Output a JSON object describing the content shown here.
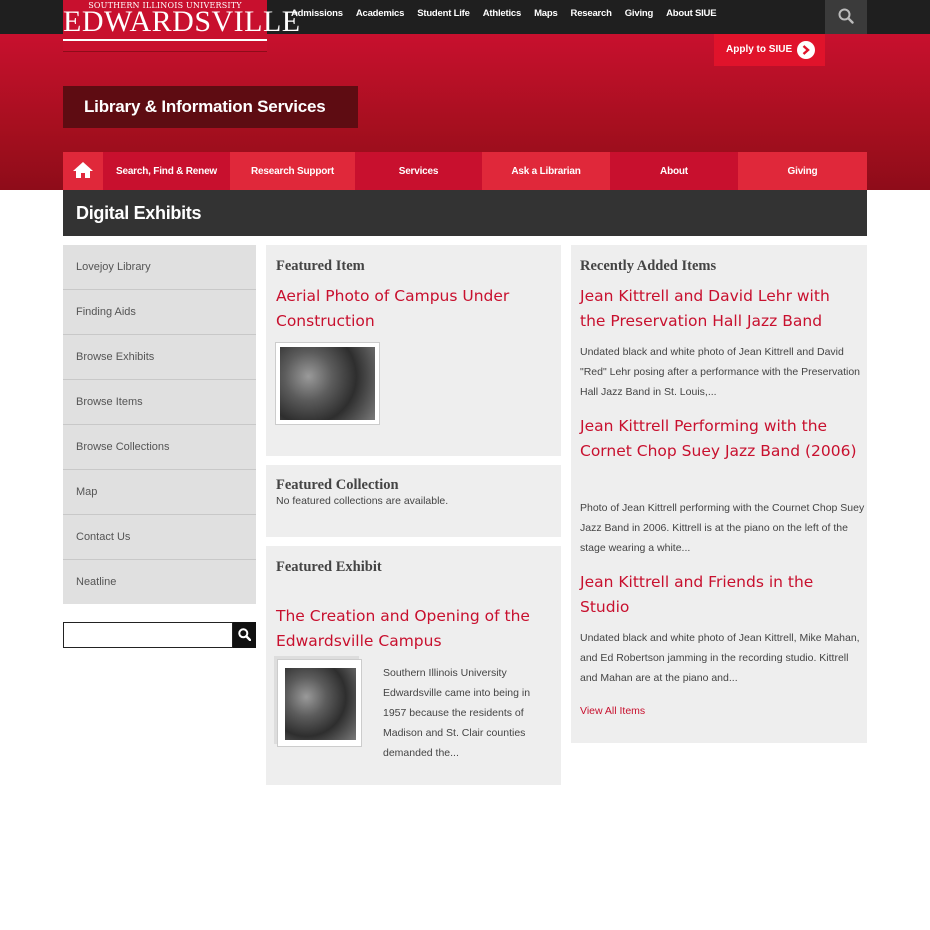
{
  "logo": {
    "small": "SOUTHERN ILLINOIS UNIVERSITY",
    "big": "EDWARDSVILLE"
  },
  "top_nav": [
    "Admissions",
    "Academics",
    "Student Life",
    "Athletics",
    "Maps",
    "Research",
    "Giving",
    "About SIUE"
  ],
  "apply_label": "Apply to SIUE",
  "site_title": "Library & Information Services",
  "main_nav": [
    "Search, Find & Renew",
    "Research Support",
    "Services",
    "Ask a Librarian",
    "About",
    "Giving"
  ],
  "page_title": "Digital Exhibits",
  "sidebar": [
    "Lovejoy Library",
    "Finding Aids",
    "Browse Exhibits",
    "Browse Items",
    "Browse Collections",
    "Map",
    "Contact Us",
    "Neatline"
  ],
  "search": {
    "value": "",
    "placeholder": ""
  },
  "featured_item": {
    "heading": "Featured Item",
    "title": "Aerial Photo of Campus Under Construction"
  },
  "featured_collection": {
    "heading": "Featured Collection",
    "text": "No featured collections are available."
  },
  "featured_exhibit": {
    "heading": "Featured Exhibit",
    "title": "The Creation and Opening of the Edwardsville Campus",
    "desc": "Southern Illinois University Edwardsville came into being in 1957 because the residents of Madison and St. Clair counties demanded the..."
  },
  "recent": {
    "heading": "Recently Added Items",
    "items": [
      {
        "title": "Jean Kittrell and David Lehr with the Preservation Hall Jazz Band",
        "desc": "Undated black and white photo of Jean Kittrell and David \"Red\" Lehr posing after a performance with the Preservation Hall Jazz Band in St. Louis,..."
      },
      {
        "title": "Jean Kittrell Performing with the Cornet Chop Suey Jazz Band (2006)",
        "desc": "Photo of Jean Kittrell performing with the Cournet Chop Suey Jazz Band in 2006. Kittrell is at the piano on the left of the stage wearing a white..."
      },
      {
        "title": "Jean Kittrell and Friends in the Studio",
        "desc": "Undated black and white photo of Jean Kittrell, Mike Mahan, and Ed Robertson jamming in the recording studio. Kittrell and Mahan are at the piano and..."
      }
    ],
    "view_all": "View All Items"
  },
  "colors": {
    "brand_red": "#c8102e",
    "nav_red": "#e0283a",
    "dark": "#333333"
  }
}
